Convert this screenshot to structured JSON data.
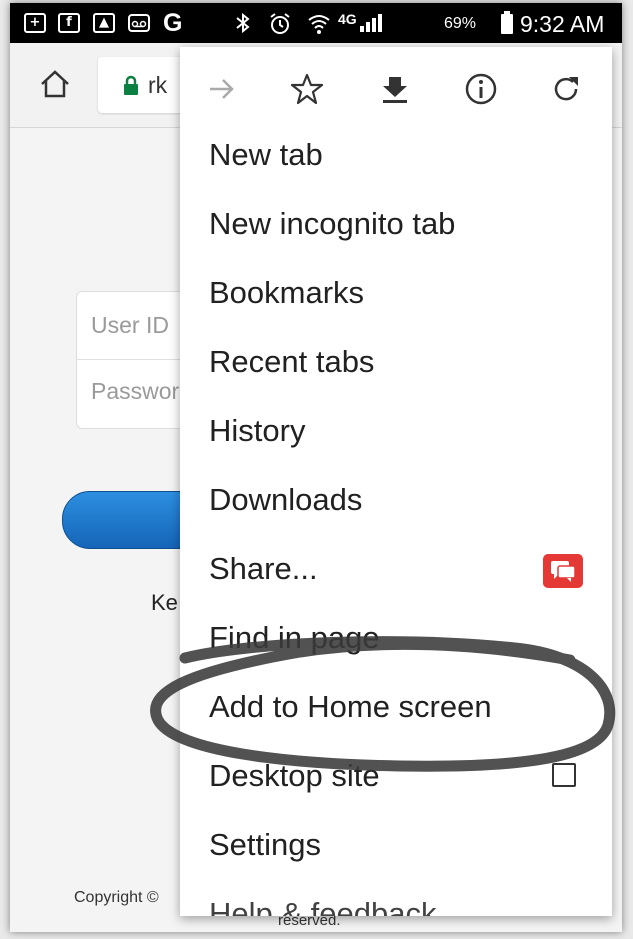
{
  "status_bar": {
    "icons": [
      "plus-box-icon",
      "facebook-icon",
      "image-icon",
      "voicemail-icon",
      "google-icon",
      "bluetooth-icon",
      "alarm-icon",
      "wifi-icon",
      "lte-signal-icon",
      "battery-icon"
    ],
    "g_letter": "G",
    "network": "4G",
    "battery_percent": "69%",
    "time": "9:32 AM"
  },
  "toolbar": {
    "url_fragment": "rk"
  },
  "page": {
    "user_id_placeholder": "User ID",
    "password_placeholder": "Password",
    "keep_text": "Ke",
    "copyright_text": "Copyright ©",
    "reserved_text": "reserved."
  },
  "menu": {
    "top_icons": [
      "forward-arrow-icon",
      "bookmark-star-icon",
      "download-icon",
      "info-icon",
      "refresh-icon"
    ],
    "items": [
      {
        "label": "New tab"
      },
      {
        "label": "New incognito tab"
      },
      {
        "label": "Bookmarks"
      },
      {
        "label": "Recent tabs"
      },
      {
        "label": "History"
      },
      {
        "label": "Downloads"
      },
      {
        "label": "Share..."
      },
      {
        "label": "Find in page"
      },
      {
        "label": "Add to Home screen"
      },
      {
        "label": "Desktop site"
      },
      {
        "label": "Settings"
      },
      {
        "label": "Help & feedback"
      }
    ]
  },
  "colors": {
    "status_bar_bg": "#000000",
    "lock_green": "#0b8043",
    "share_badge": "#e53935",
    "login_button": "#1f78d1",
    "annotation_ink": "#3a3a3a"
  }
}
